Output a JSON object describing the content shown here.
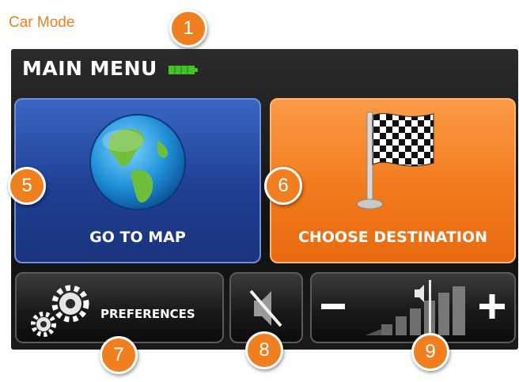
{
  "caption": "Car Mode",
  "header": {
    "title": "MAIN MENU",
    "battery_icon": "battery-full-icon",
    "battery_color": "#43c22a"
  },
  "buttons": {
    "map": {
      "label": "GO TO MAP",
      "icon": "globe-icon"
    },
    "destination": {
      "label": "CHOOSE DESTINATION",
      "icon": "checkered-flag-icon"
    },
    "preferences": {
      "label": "PREFERENCES",
      "icon": "gears-icon"
    },
    "mute": {
      "icon": "speaker-muted-icon"
    },
    "volume": {
      "minus": "−",
      "plus": "+",
      "icon": "volume-level-icon"
    }
  },
  "callouts": [
    "1",
    "5",
    "6",
    "7",
    "8",
    "9"
  ],
  "colors": {
    "accent": "#f07f1f",
    "blue_button": "#2a4fa8",
    "orange_button": "#f5862a",
    "screen_bg": "#1a1a1a"
  }
}
